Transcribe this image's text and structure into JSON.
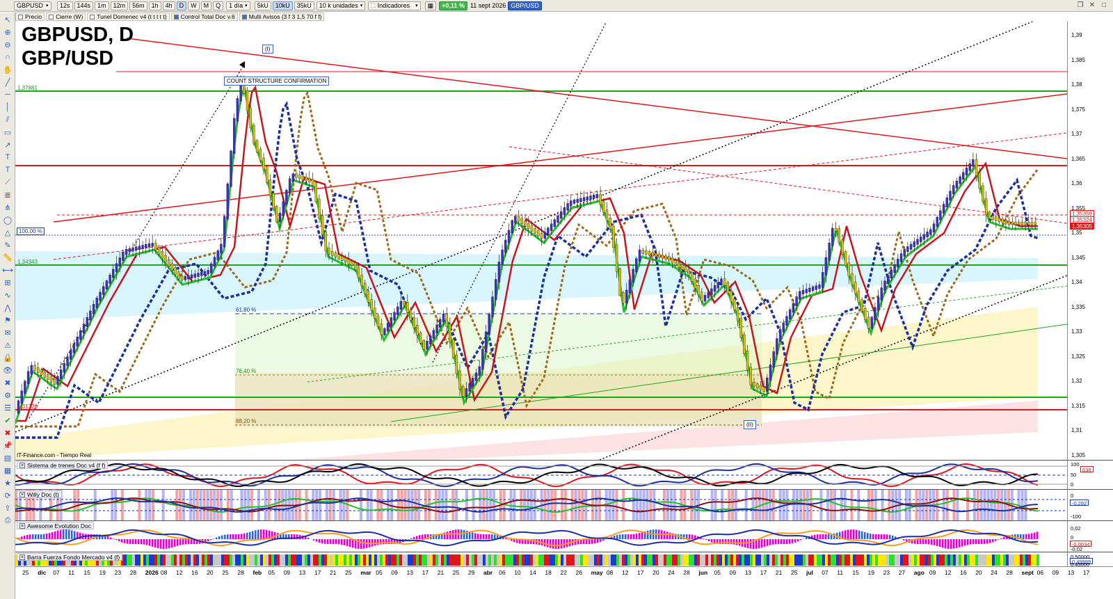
{
  "toolbar": {
    "symbol": "GBPUSD",
    "timeframes": [
      "12s",
      "144s",
      "1m",
      "12m",
      "56m",
      "1h",
      "4h",
      "D",
      "W",
      "M",
      "Q"
    ],
    "period": "1 día",
    "unit_buttons": [
      "5kU",
      "10kU",
      "35kU"
    ],
    "units": "10 k unidades",
    "indicators_label": "Indicadores",
    "change": "+0,11 %",
    "date": "11 sept 2026",
    "instrument_badge": "GBP/USD"
  },
  "indicator_row": [
    {
      "label": "Precio",
      "checked": false
    },
    {
      "label": "Cierre (W)",
      "checked": false
    },
    {
      "label": "Tunel Domenec v4 (t t t t t)",
      "checked": false
    },
    {
      "label": "Control Total Doc v.6",
      "checked": true
    },
    {
      "label": "Multi Avisos (3 f 3 1,5 70 f f)",
      "checked": true
    }
  ],
  "chart": {
    "title_line1": "GBPUSD, D",
    "title_line2": "GBP/USD",
    "source": "IT-Finance.com - Tiempo Real",
    "annotation_wave_i": "(I)",
    "annotation_wave_ii": "(II)",
    "annotation_box": "COUNT STRUCTURE CONFIRMATION",
    "fib_100": "100,00 %",
    "fib_618": "61,80 %",
    "fib_764": "76,40 %",
    "fib_882": "88,20 %",
    "level_high": "1,37881",
    "level_mid": "1,34343",
    "level_low": "1,31726",
    "price_labels": [
      "1,39",
      "1,385",
      "1,38",
      "1,375",
      "1,37",
      "1,365",
      "1,36",
      "1,355",
      "1,35",
      "1,345",
      "1,34",
      "1,335",
      "1,33",
      "1,325",
      "1,32",
      "1,315",
      "1,31",
      "1,305"
    ],
    "tag_a": "1,35359",
    "tag_b": "1,35324",
    "tag_c": "1,35305",
    "colors": {
      "support": "#1fa31f",
      "resistance": "#e0141b",
      "bull_candle": "#3b2fcf",
      "bear_candle": "#d8c100"
    }
  },
  "panels": {
    "trains": {
      "title": "Sistema de trenes Doc v4 (f f)",
      "scale": [
        "100",
        "50",
        "0"
      ],
      "tag": "638"
    },
    "willy": {
      "title": "Willy Doc (t)",
      "scale": [
        "0",
        "-100"
      ],
      "tag": "-0,292"
    },
    "awesome": {
      "title": "Awesome Evolution Doc",
      "scale": [
        "0,02",
        "0",
        "-0,02"
      ],
      "tag": "-0,0034"
    },
    "barra": {
      "title": "Barra Fuerza Fondo Mercado v4 (f)",
      "scale": [
        "0,50000",
        "0,45000"
      ],
      "tag": "0,49999"
    }
  },
  "time_axis": [
    {
      "t": "25",
      "m": false
    },
    {
      "t": "dic",
      "m": true
    },
    {
      "t": "07",
      "m": false
    },
    {
      "t": "11",
      "m": false
    },
    {
      "t": "15",
      "m": false
    },
    {
      "t": "19",
      "m": false
    },
    {
      "t": "23",
      "m": false
    },
    {
      "t": "28",
      "m": false
    },
    {
      "t": "2026",
      "m": true
    },
    {
      "t": "08",
      "m": false
    },
    {
      "t": "12",
      "m": false
    },
    {
      "t": "16",
      "m": false
    },
    {
      "t": "20",
      "m": false
    },
    {
      "t": "25",
      "m": false
    },
    {
      "t": "28",
      "m": false
    },
    {
      "t": "feb",
      "m": true
    },
    {
      "t": "05",
      "m": false
    },
    {
      "t": "09",
      "m": false
    },
    {
      "t": "13",
      "m": false
    },
    {
      "t": "17",
      "m": false
    },
    {
      "t": "21",
      "m": false
    },
    {
      "t": "25",
      "m": false
    },
    {
      "t": "mar",
      "m": true
    },
    {
      "t": "05",
      "m": false
    },
    {
      "t": "09",
      "m": false
    },
    {
      "t": "13",
      "m": false
    },
    {
      "t": "17",
      "m": false
    },
    {
      "t": "21",
      "m": false
    },
    {
      "t": "25",
      "m": false
    },
    {
      "t": "29",
      "m": false
    },
    {
      "t": "abr",
      "m": true
    },
    {
      "t": "06",
      "m": false
    },
    {
      "t": "10",
      "m": false
    },
    {
      "t": "14",
      "m": false
    },
    {
      "t": "18",
      "m": false
    },
    {
      "t": "22",
      "m": false
    },
    {
      "t": "26",
      "m": false
    },
    {
      "t": "may",
      "m": true
    },
    {
      "t": "08",
      "m": false
    },
    {
      "t": "12",
      "m": false
    },
    {
      "t": "17",
      "m": false
    },
    {
      "t": "20",
      "m": false
    },
    {
      "t": "24",
      "m": false
    },
    {
      "t": "28",
      "m": false
    },
    {
      "t": "jun",
      "m": true
    },
    {
      "t": "05",
      "m": false
    },
    {
      "t": "09",
      "m": false
    },
    {
      "t": "13",
      "m": false
    },
    {
      "t": "17",
      "m": false
    },
    {
      "t": "21",
      "m": false
    },
    {
      "t": "25",
      "m": false
    },
    {
      "t": "jul",
      "m": true
    },
    {
      "t": "07",
      "m": false
    },
    {
      "t": "11",
      "m": false
    },
    {
      "t": "15",
      "m": false
    },
    {
      "t": "19",
      "m": false
    },
    {
      "t": "23",
      "m": false
    },
    {
      "t": "27",
      "m": false
    },
    {
      "t": "ago",
      "m": true
    },
    {
      "t": "09",
      "m": false
    },
    {
      "t": "12",
      "m": false
    },
    {
      "t": "16",
      "m": false
    },
    {
      "t": "20",
      "m": false
    },
    {
      "t": "24",
      "m": false
    },
    {
      "t": "28",
      "m": false
    },
    {
      "t": "sept",
      "m": true
    },
    {
      "t": "06",
      "m": false
    },
    {
      "t": "09",
      "m": false
    },
    {
      "t": "13",
      "m": false
    },
    {
      "t": "17",
      "m": false
    }
  ]
}
